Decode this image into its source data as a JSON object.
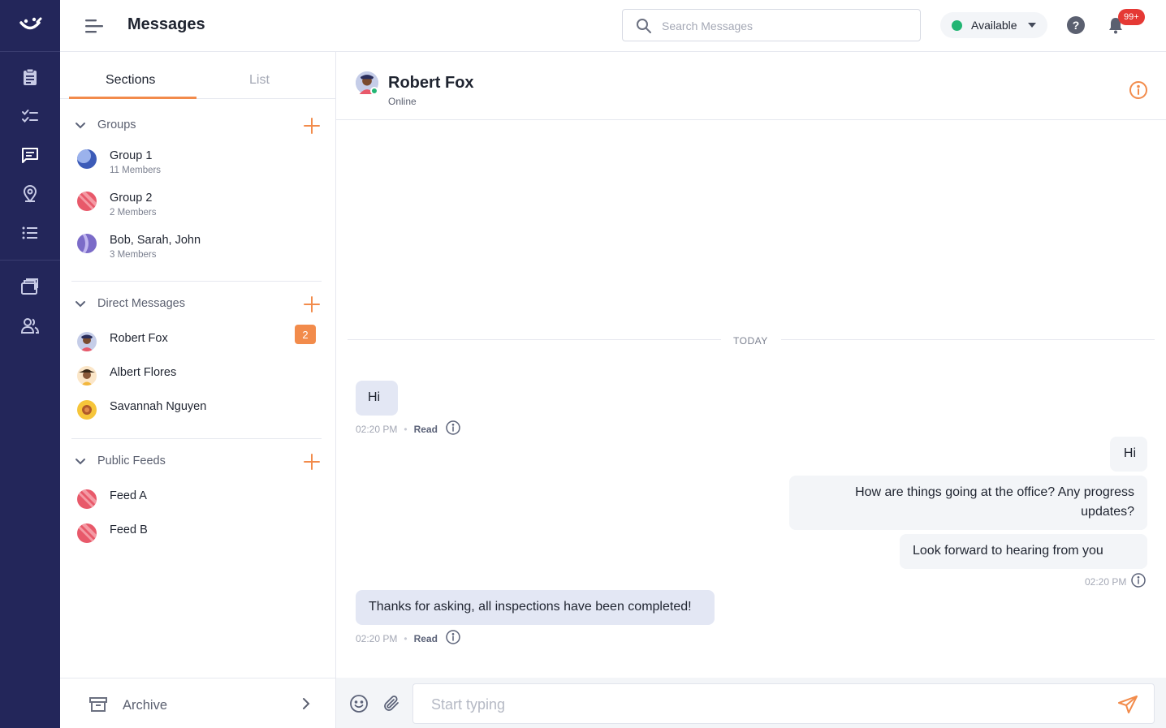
{
  "header": {
    "title": "Messages",
    "search_placeholder": "Search Messages",
    "status_label": "Available",
    "help_label": "?",
    "notifications_badge": "99+"
  },
  "rail": {
    "items": [
      "logo-icon",
      "clipboard-icon",
      "checklist-icon",
      "chat-icon",
      "location-pin-icon",
      "list-icon",
      "briefcase-icon",
      "users-icon"
    ]
  },
  "panel": {
    "tabs": [
      {
        "label": "Sections",
        "active": true
      },
      {
        "label": "List",
        "active": false
      }
    ],
    "groups": {
      "title": "Groups",
      "items": [
        {
          "name": "Group 1",
          "sub": "11 Members",
          "color": "#3c5bb8"
        },
        {
          "name": "Group 2",
          "sub": "2 Members",
          "color": "#e8596a"
        },
        {
          "name": "Bob, Sarah, John",
          "sub": "3 Members",
          "color": "#7b6bc8"
        }
      ]
    },
    "direct": {
      "title": "Direct Messages",
      "items": [
        {
          "name": "Robert Fox",
          "count": "2"
        },
        {
          "name": "Albert Flores"
        },
        {
          "name": "Savannah Nguyen"
        }
      ]
    },
    "feeds": {
      "title": "Public Feeds",
      "items": [
        {
          "name": "Feed A",
          "color": "#e8596a"
        },
        {
          "name": "Feed B",
          "color": "#e8596a"
        }
      ]
    },
    "archive_label": "Archive"
  },
  "chat": {
    "contact_name": "Robert Fox",
    "contact_status": "Online",
    "day_label": "TODAY",
    "messages": [
      {
        "dir": "in",
        "text": "Hi",
        "time": "02:20 PM",
        "receipt": "Read"
      },
      {
        "dir": "out",
        "text": "Hi"
      },
      {
        "dir": "out",
        "text": "How are things going at the office? Any progress updates?"
      },
      {
        "dir": "out",
        "text": "Look forward to hearing from you",
        "time": "02:20 PM"
      },
      {
        "dir": "in",
        "text": "Thanks for asking, all inspections have been completed!",
        "time": "02:20 PM",
        "receipt": "Read"
      }
    ],
    "composer_placeholder": "Start typing"
  },
  "colors": {
    "rail_bg": "#23265a",
    "accent": "#f28b4b",
    "online": "#22b573",
    "badge": "#e53935"
  }
}
